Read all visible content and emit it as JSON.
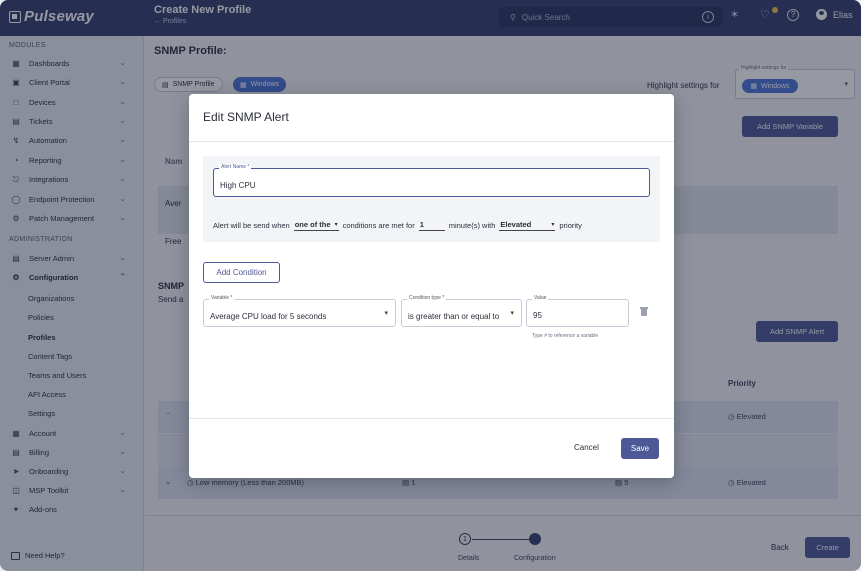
{
  "app": {
    "logo": "Pulseway"
  },
  "header": {
    "title": "Create New Profile",
    "breadcrumb": "← Profiles",
    "search_placeholder": "Quick Search",
    "notification_count": "",
    "user": "Elias"
  },
  "sidebar": {
    "modules_title": "MODULES",
    "modules": [
      {
        "label": "Dashboards",
        "icon": "grid-icon"
      },
      {
        "label": "Client Portal",
        "icon": "portal-icon"
      },
      {
        "label": "Devices",
        "icon": "devices-icon"
      },
      {
        "label": "Tickets",
        "icon": "ticket-icon"
      },
      {
        "label": "Automation",
        "icon": "automation-icon"
      },
      {
        "label": "Reporting",
        "icon": "report-icon"
      },
      {
        "label": "Integrations",
        "icon": "plug-icon"
      },
      {
        "label": "Endpoint Protection",
        "icon": "shield-icon"
      },
      {
        "label": "Patch Management",
        "icon": "patch-icon"
      }
    ],
    "admin_title": "ADMINISTRATION",
    "admin": [
      {
        "label": "Server Admin",
        "icon": "server-icon"
      },
      {
        "label": "Configuration",
        "icon": "gear-icon"
      }
    ],
    "config_sub": [
      "Organizations",
      "Policies",
      "Profiles",
      "Content Tags",
      "Teams and Users",
      "API Access",
      "Settings"
    ],
    "admin_rest": [
      {
        "label": "Account",
        "icon": "account-icon"
      },
      {
        "label": "Billing",
        "icon": "billing-icon"
      },
      {
        "label": "Onboarding",
        "icon": "onboarding-icon"
      },
      {
        "label": "MSP Toolkit",
        "icon": "toolkit-icon"
      },
      {
        "label": "Add-ons",
        "icon": "addons-icon"
      }
    ],
    "need_help": "Need Help?"
  },
  "main": {
    "title": "SNMP Profile:",
    "chip_profile": "SNMP Profile",
    "chip_os": "Windows",
    "highlight_label": "Highlight settings for",
    "highlight_field_label": "Highlight settings for",
    "highlight_value": "Windows",
    "add_variable": "Add SNMP Variable",
    "bg_name": "Nam",
    "bg_aver": "Aver",
    "bg_free": "Free",
    "bg_snmp": "SNMP",
    "bg_senda": "Send a",
    "add_alert": "Add SNMP Alert",
    "priority_header": "Priority",
    "row1_priority": "Elevated",
    "row2_label": "Low memory (Less than 200MB)",
    "row2_count1": "1",
    "row2_count2": "5",
    "row2_priority": "Elevated"
  },
  "footer": {
    "step1_number": "1",
    "step1": "Details",
    "step2": "Configuration",
    "back": "Back",
    "create": "Create"
  },
  "modal": {
    "title": "Edit SNMP Alert",
    "alert_name_label": "Alert Name *",
    "alert_name_value": "High CPU",
    "cond_prefix": "Alert will be send when",
    "cond_match": "one of the",
    "cond_mid": "conditions are met for",
    "cond_minutes": "1",
    "cond_minutes_suffix": "minute(s) with",
    "cond_priority": "Elevated",
    "cond_suffix": "priority",
    "add_condition": "Add Condition",
    "variable_label": "Variable *",
    "variable_value": "Average CPU load for 5 seconds",
    "condition_type_label": "Condition type *",
    "condition_type_value": "is greater than or equal to",
    "value_label": "Value",
    "value_value": "95",
    "value_hint": "Type # to reference a variable",
    "cancel": "Cancel",
    "save": "Save"
  }
}
